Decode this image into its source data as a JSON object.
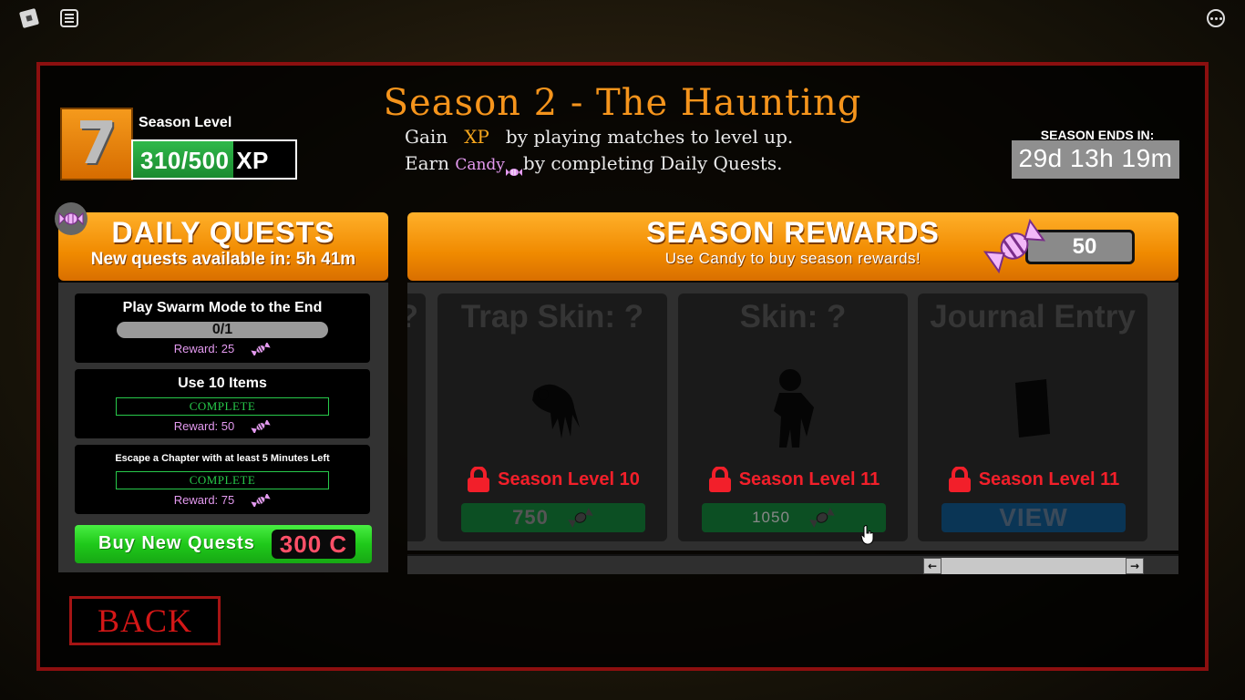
{
  "topbar": {
    "roblox_icon": "roblox-logo-icon",
    "chat_icon": "chat-icon",
    "menu_icon": "more-options-icon"
  },
  "header": {
    "level_number": "7",
    "level_label": "Season Level",
    "xp_text": "310/500 XP",
    "xp_progress": 0.62,
    "title": "Season 2 - The Haunting",
    "sub1_prefix": "Gain",
    "sub1_xp": "XP",
    "sub1_suffix": "by playing matches to level up.",
    "sub2_prefix": "Earn",
    "sub2_candy": "Candy",
    "sub2_suffix": "by completing Daily Quests.",
    "ends_label": "SEASON ENDS IN:",
    "ends_value": "29d 13h 19m"
  },
  "daily_quests": {
    "title": "DAILY QUESTS",
    "subtitle": "New quests available in: 5h 41m",
    "quests": [
      {
        "title": "Play Swarm Mode to the End",
        "progress": "0/1",
        "reward": "Reward: 25"
      },
      {
        "title": "Use 10 Items",
        "status": "COMPLETE",
        "reward": "Reward: 50"
      },
      {
        "title": "Escape a Chapter with at least 5 Minutes Left",
        "status": "COMPLETE",
        "reward": "Reward: 75"
      }
    ],
    "buy_label": "Buy New Quests",
    "buy_price": "300 C"
  },
  "season_rewards": {
    "title": "SEASON REWARDS",
    "subtitle": "Use Candy to buy season rewards!",
    "candy_count": "50",
    "partial_card_title": "?",
    "cards": [
      {
        "title": "Trap Skin: ?",
        "lock": "Season Level 10",
        "button": "750",
        "icon": "trap-claw-silhouette"
      },
      {
        "title": "Skin: ?",
        "lock": "Season Level 11",
        "button": "1050",
        "icon": "character-silhouette"
      },
      {
        "title": "Journal Entry",
        "lock": "Season Level 11",
        "button": "VIEW",
        "icon": "journal-book-silhouette"
      }
    ],
    "scroll_left": "←",
    "scroll_right": "→"
  },
  "back_label": "BACK",
  "colors": {
    "frame_border": "#8c0f0f",
    "orange": "#f08a00",
    "title_orange": "#f5941c",
    "candy_pink": "#e49af0",
    "lock_red": "#f21f2a",
    "complete_green": "#27c94a",
    "buy_green": "#1fc91a",
    "price_red": "#ff5068"
  }
}
